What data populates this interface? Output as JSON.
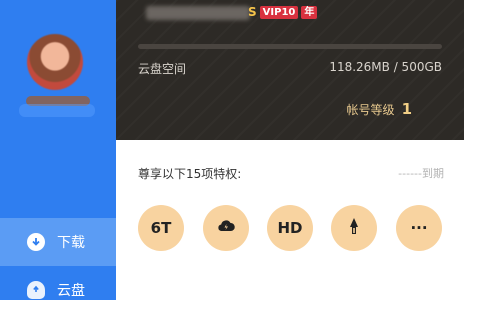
{
  "sidebar": {
    "items": [
      {
        "label": "下载",
        "icon": "download-icon"
      },
      {
        "label": "云盘",
        "icon": "cloud-icon"
      }
    ],
    "active_color": "#5b9cf4",
    "bg_color": "#2f7ef0"
  },
  "popup": {
    "vip_badge": {
      "s": "S",
      "tag1": "VIP10",
      "tag2": "年"
    },
    "storage": {
      "label": "云盘空间",
      "value": "118.26MB / 500GB",
      "used_fraction": 0.0002
    },
    "account_level": {
      "label": "帐号等级",
      "value": "1"
    },
    "privileges": {
      "title": "尊享以下15项特权:",
      "expire_text": "------到期",
      "items": [
        {
          "label": "6T",
          "icon": "storage-6t-icon"
        },
        {
          "label": "",
          "icon": "cloud-speed-icon"
        },
        {
          "label": "HD",
          "icon": "hd-video-icon"
        },
        {
          "label": "",
          "icon": "rocket-icon"
        },
        {
          "label": "···",
          "icon": "more-icon"
        }
      ]
    }
  }
}
